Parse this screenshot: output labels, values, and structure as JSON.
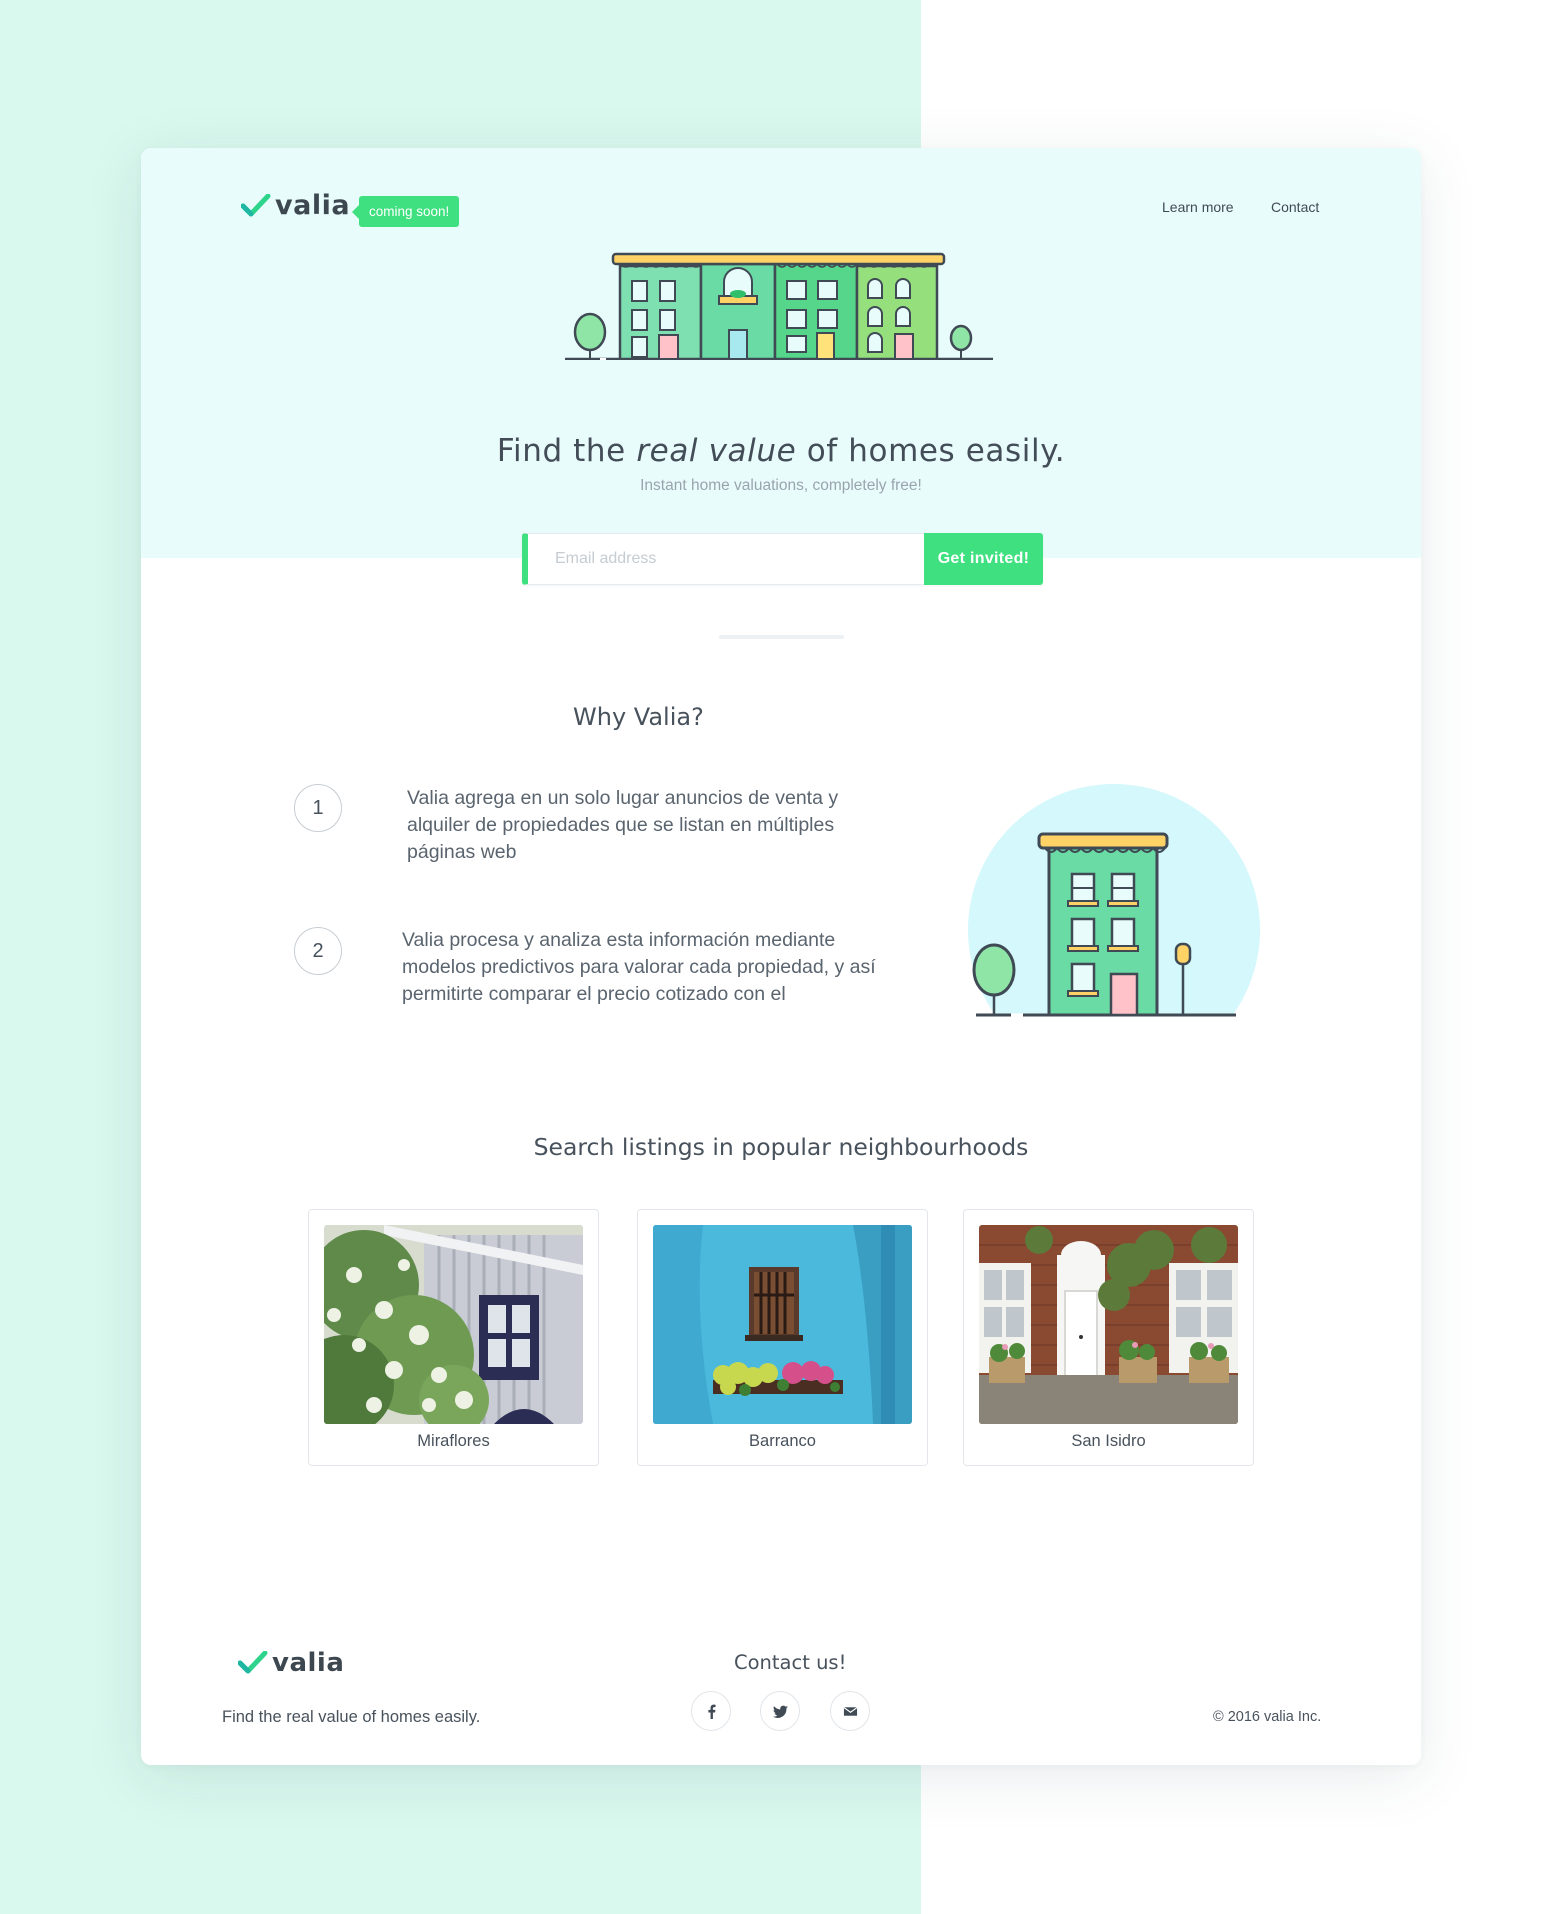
{
  "header": {
    "logo_text": "valia",
    "badge": "coming soon!",
    "nav": [
      "Learn more",
      "Contact"
    ]
  },
  "hero": {
    "headline_pre": "Find the ",
    "headline_em": "real value",
    "headline_post": " of homes easily.",
    "subline": "Instant home valuations, completely free!",
    "email_placeholder": "Email address",
    "cta_label": "Get invited!"
  },
  "why": {
    "title": "Why Valia?",
    "steps": [
      {
        "number": "1",
        "text": "Valia agrega en un solo lugar anuncios de venta y alquiler de propiedades que se listan en múltiples páginas web"
      },
      {
        "number": "2",
        "text": "Valia procesa y analiza esta información mediante modelos predictivos para valorar cada propiedad, y así permitirte comparar el precio cotizado con el"
      }
    ]
  },
  "neighbourhoods": {
    "title": "Search listings in popular neighbourhoods",
    "items": [
      {
        "name": "Miraflores"
      },
      {
        "name": "Barranco"
      },
      {
        "name": "San Isidro"
      }
    ]
  },
  "footer": {
    "logo_text": "valia",
    "tagline": "Find the real value of homes easily.",
    "contact_title": "Contact us!",
    "social": [
      "facebook-icon",
      "twitter-icon",
      "mail-icon"
    ],
    "copyright": "© 2016 valia Inc."
  },
  "colors": {
    "accent": "#3ee07f",
    "hero_bg": "#e9fcfc",
    "page_left_bg": "#d9f8ee",
    "text": "#48525c"
  }
}
